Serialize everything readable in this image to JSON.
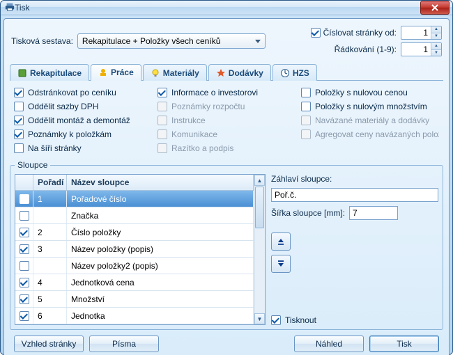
{
  "window": {
    "title": "Tisk"
  },
  "top": {
    "sestava_label": "Tisková sestava:",
    "sestava_value": "Rekapitulace + Položky všech ceníků",
    "cislovat_label": "Číslovat stránky od:",
    "cislovat_value": "1",
    "radkovani_label": "Řádkování (1-9):",
    "radkovani_value": "1"
  },
  "tabs": [
    {
      "label": "Rekapitulace",
      "icon": "book-icon"
    },
    {
      "label": "Práce",
      "icon": "worker-icon"
    },
    {
      "label": "Materiály",
      "icon": "bulb-icon"
    },
    {
      "label": "Dodávky",
      "icon": "star-icon"
    },
    {
      "label": "HZS",
      "icon": "clock-icon"
    }
  ],
  "active_tab": 1,
  "options": {
    "col1": [
      {
        "label": "Odstránkovat po ceníku",
        "checked": true,
        "disabled": false
      },
      {
        "label": "Oddělit sazby DPH",
        "checked": false,
        "disabled": false
      },
      {
        "label": "Oddělit montáž a demontáž",
        "checked": true,
        "disabled": false
      },
      {
        "label": "Poznámky k položkám",
        "checked": true,
        "disabled": false
      },
      {
        "label": "Na šíři stránky",
        "checked": false,
        "disabled": false
      }
    ],
    "col2": [
      {
        "label": "Informace o investorovi",
        "checked": true,
        "disabled": false
      },
      {
        "label": "Poznámky rozpočtu",
        "checked": false,
        "disabled": true
      },
      {
        "label": "Instrukce",
        "checked": false,
        "disabled": true
      },
      {
        "label": "Komunikace",
        "checked": false,
        "disabled": true
      },
      {
        "label": "Razítko a podpis",
        "checked": false,
        "disabled": true
      }
    ],
    "col3": [
      {
        "label": "Položky s nulovou cenou",
        "checked": false,
        "disabled": false
      },
      {
        "label": "Položky s nulovým množstvím",
        "checked": false,
        "disabled": false
      },
      {
        "label": "Navázané materiály a dodávky",
        "checked": false,
        "disabled": true
      },
      {
        "label": "Agregovat ceny navázaných položek",
        "checked": false,
        "disabled": true
      }
    ]
  },
  "columns_group": {
    "legend": "Sloupce"
  },
  "table": {
    "headers": {
      "poradi": "Pořadí",
      "nazev": "Název sloupce"
    },
    "rows": [
      {
        "checked": true,
        "order": "1",
        "name": "Pořadové číslo",
        "selected": true
      },
      {
        "checked": false,
        "order": "",
        "name": "Značka",
        "selected": false
      },
      {
        "checked": true,
        "order": "2",
        "name": "Číslo položky",
        "selected": false
      },
      {
        "checked": true,
        "order": "3",
        "name": "Název položky (popis)",
        "selected": false
      },
      {
        "checked": false,
        "order": "",
        "name": "Název položky2 (popis)",
        "selected": false
      },
      {
        "checked": true,
        "order": "4",
        "name": "Jednotková cena",
        "selected": false
      },
      {
        "checked": true,
        "order": "5",
        "name": "Množství",
        "selected": false
      },
      {
        "checked": true,
        "order": "6",
        "name": "Jednotka",
        "selected": false
      }
    ]
  },
  "side": {
    "zahlavi_label": "Záhlaví sloupce:",
    "zahlavi_value": "Poř.č.",
    "sirka_label": "Šířka sloupce [mm]:",
    "sirka_value": "7",
    "tisknout_label": "Tisknout",
    "tisknout_checked": true
  },
  "footer": {
    "vzhled": "Vzhled stránky",
    "pisma": "Písma",
    "nahled": "Náhled",
    "tisk": "Tisk"
  }
}
